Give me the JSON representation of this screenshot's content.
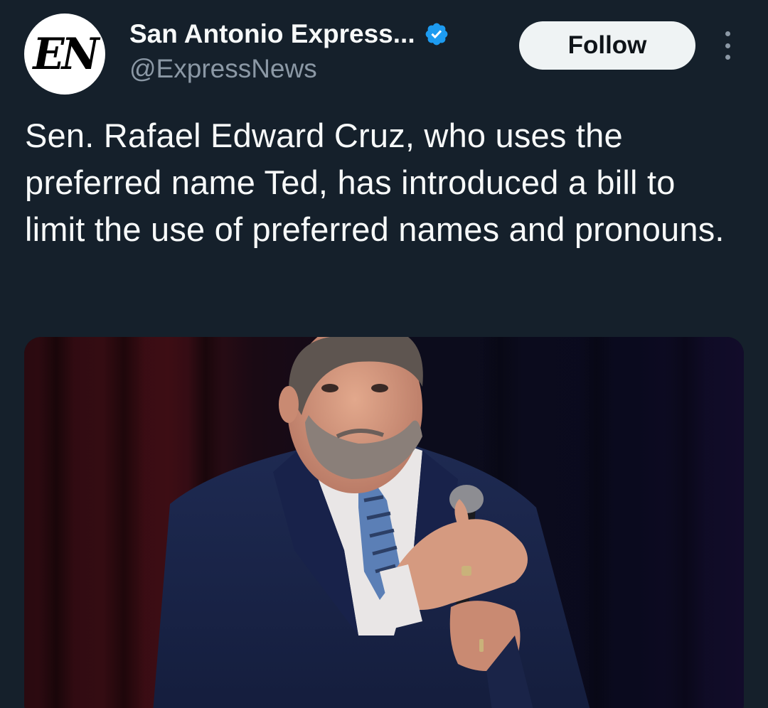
{
  "account": {
    "avatar_text": "EN",
    "display_name": "San Antonio Express...",
    "handle": "@ExpressNews",
    "verified_icon": "verified-badge-icon",
    "verified_color": "#1d9bf0"
  },
  "actions": {
    "follow_label": "Follow",
    "more_icon": "more-vertical-icon"
  },
  "tweet": {
    "text": "Sen. Rafael Edward Cruz, who uses the preferred name Ted, has introduced a bill to limit the use of preferred names and pronouns."
  },
  "media": {
    "type": "photo"
  },
  "colors": {
    "background": "#15202b",
    "text_primary": "#f7f9f9",
    "text_secondary": "#8b98a5",
    "button_bg": "#eff3f4"
  }
}
